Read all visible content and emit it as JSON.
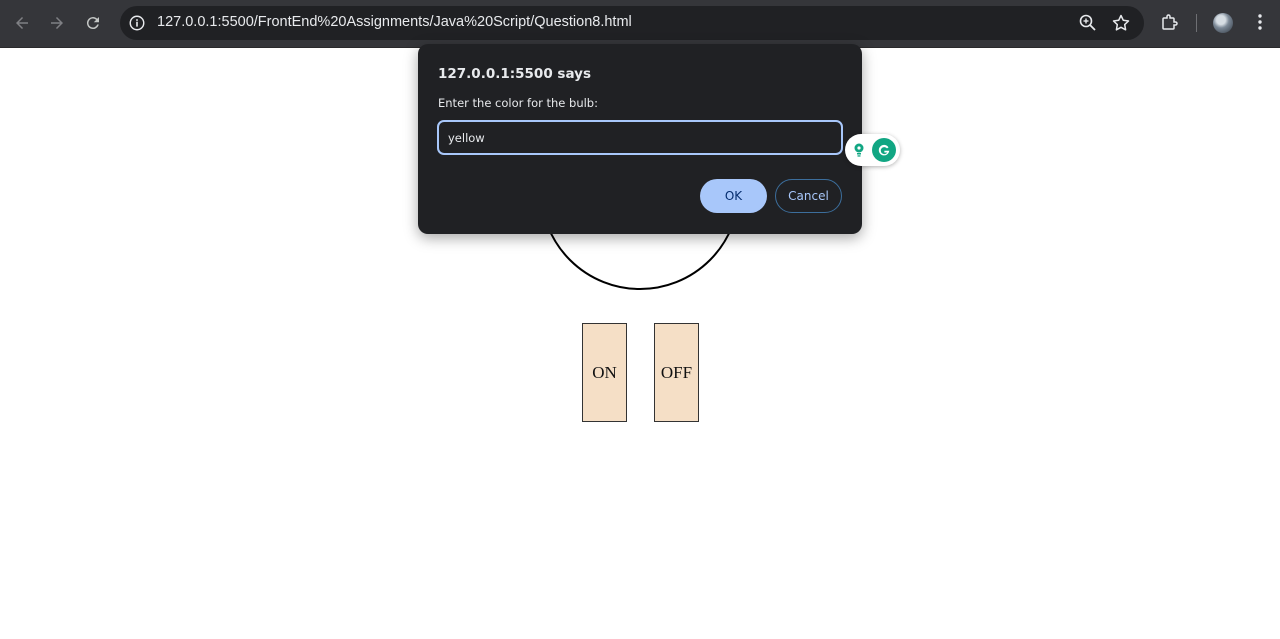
{
  "browser": {
    "url": "127.0.0.1:5500/FrontEnd%20Assignments/Java%20Script/Question8.html",
    "icons": [
      "back-icon",
      "forward-icon",
      "reload-icon",
      "site-info-icon",
      "zoom-icon",
      "bookmark-star-icon",
      "extensions-icon",
      "profile-avatar",
      "menu-icon"
    ]
  },
  "page": {
    "switch_on_label": "ON",
    "switch_off_label": "OFF"
  },
  "dialog": {
    "title": "127.0.0.1:5500 says",
    "message": "Enter the color for the bulb:",
    "input_value": "yellow",
    "ok_label": "OK",
    "cancel_label": "Cancel"
  },
  "colors": {
    "accent": "#a8c7fa",
    "dialog_bg": "#202124",
    "switch_bg": "#f5dfc6",
    "grammarly": "#11a683"
  }
}
